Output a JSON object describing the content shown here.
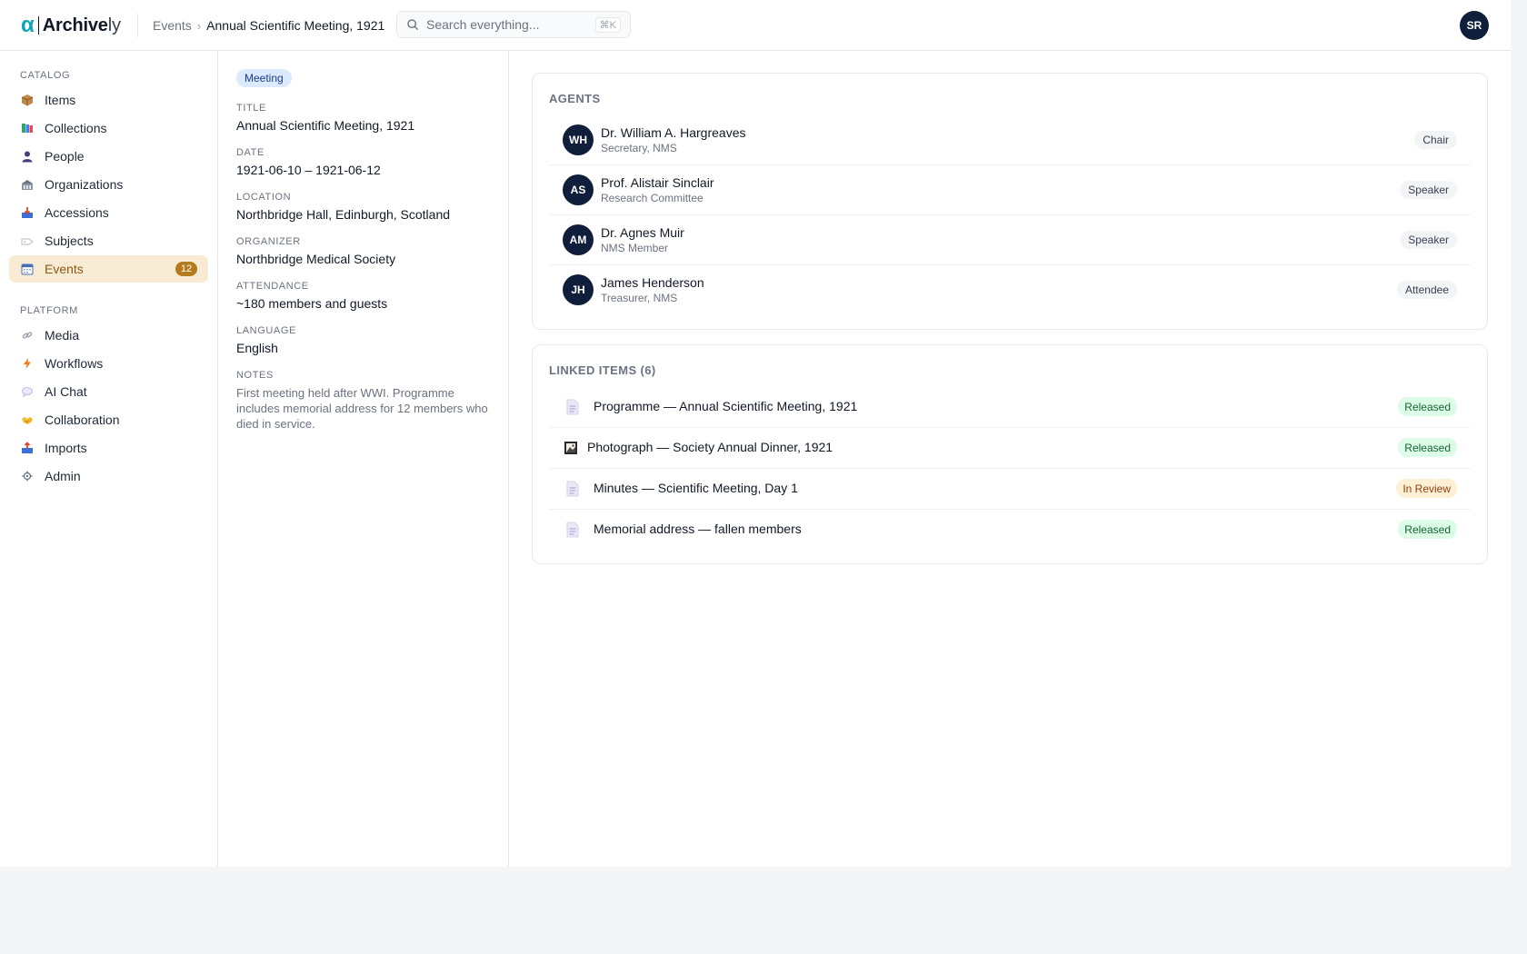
{
  "header": {
    "logo_mark": "α",
    "logo_bold": "Archive",
    "logo_thin": "ly",
    "breadcrumb_parent": "Events",
    "breadcrumb_sep": "›",
    "breadcrumb_current": "Annual Scientific Meeting, 1921",
    "search_placeholder": "Search everything...",
    "search_shortcut": "⌘K",
    "user_initials": "SR"
  },
  "sidebar": {
    "section_catalog": "CATALOG",
    "section_platform": "PLATFORM",
    "catalog_items": [
      {
        "label": "Items",
        "icon": "box-icon"
      },
      {
        "label": "Collections",
        "icon": "books-icon"
      },
      {
        "label": "People",
        "icon": "person-icon"
      },
      {
        "label": "Organizations",
        "icon": "building-icon"
      },
      {
        "label": "Accessions",
        "icon": "inbox-icon"
      },
      {
        "label": "Subjects",
        "icon": "tag-icon"
      },
      {
        "label": "Events",
        "icon": "calendar-icon",
        "active": true,
        "badge": "12"
      }
    ],
    "platform_items": [
      {
        "label": "Media",
        "icon": "link-icon"
      },
      {
        "label": "Workflows",
        "icon": "lightning-icon"
      },
      {
        "label": "AI Chat",
        "icon": "chat-icon"
      },
      {
        "label": "Collaboration",
        "icon": "handshake-icon"
      },
      {
        "label": "Imports",
        "icon": "upload-icon"
      },
      {
        "label": "Admin",
        "icon": "gear-icon"
      }
    ]
  },
  "detail": {
    "type": "Meeting",
    "fields": [
      {
        "label": "TITLE",
        "value": "Annual Scientific Meeting, 1921"
      },
      {
        "label": "DATE",
        "value": "1921-06-10 – 1921-06-12"
      },
      {
        "label": "LOCATION",
        "value": "Northbridge Hall, Edinburgh, Scotland"
      },
      {
        "label": "ORGANIZER",
        "value": "Northbridge Medical Society"
      },
      {
        "label": "ATTENDANCE",
        "value": "~180 members and guests"
      },
      {
        "label": "LANGUAGE",
        "value": "English"
      },
      {
        "label": "NOTES",
        "value": "First meeting held after WWI. Programme includes memorial address for 12 members who died in service."
      }
    ]
  },
  "agents": {
    "title": "AGENTS",
    "rows": [
      {
        "initials": "WH",
        "name": "Dr. William A. Hargreaves",
        "subtitle": "Secretary, NMS",
        "role": "Chair"
      },
      {
        "initials": "AS",
        "name": "Prof. Alistair Sinclair",
        "subtitle": "Research Committee",
        "role": "Speaker"
      },
      {
        "initials": "AM",
        "name": "Dr. Agnes Muir",
        "subtitle": "NMS Member",
        "role": "Speaker"
      },
      {
        "initials": "JH",
        "name": "James Henderson",
        "subtitle": "Treasurer, NMS",
        "role": "Attendee"
      }
    ]
  },
  "linked_items": {
    "title": "LINKED ITEMS (6)",
    "rows": [
      {
        "icon": "document-icon",
        "title": "Programme — Annual Scientific Meeting, 1921",
        "status": "Released"
      },
      {
        "icon": "photo-icon",
        "title": "Photograph — Society Annual Dinner, 1921",
        "status": "Released"
      },
      {
        "icon": "document-icon",
        "title": "Minutes — Scientific Meeting, Day 1",
        "status": "In Review"
      },
      {
        "icon": "document-icon",
        "title": "Memorial address — fallen members",
        "status": "Released"
      }
    ]
  },
  "colors": {
    "brand": "#0ea5b7",
    "navy_avatar": "#0f1e3a",
    "active_nav_bg": "#f7ebd3",
    "active_nav_text": "#8a5a12",
    "badge": "#b47a1c",
    "released_bg": "#dcfce7",
    "released_text": "#166534",
    "review_bg": "#fdf0d5",
    "review_text": "#92400e"
  }
}
